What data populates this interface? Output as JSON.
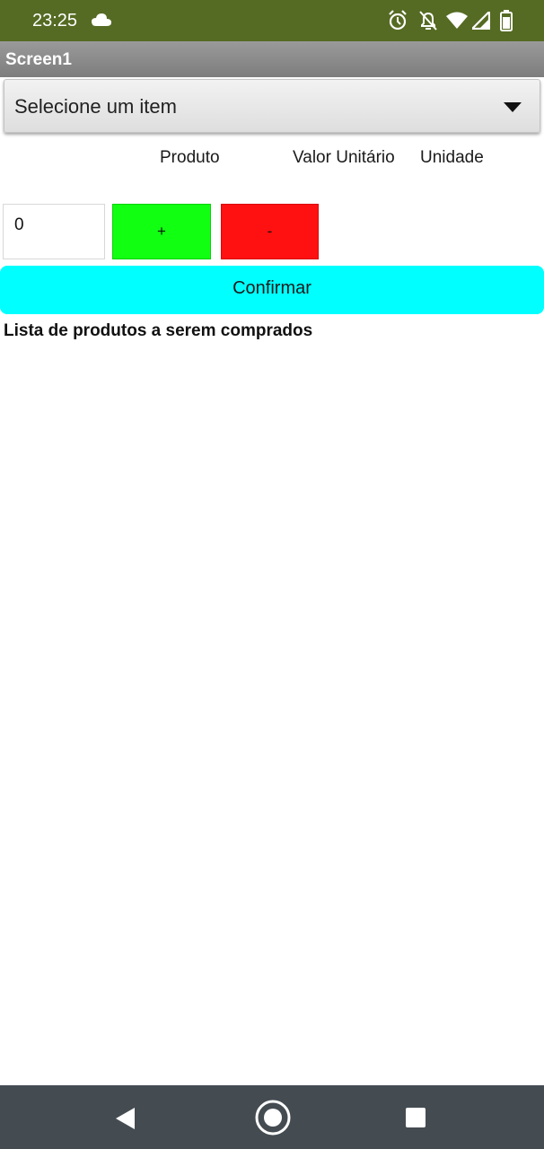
{
  "status_bar": {
    "time": "23:25",
    "icons": [
      "cloud-icon",
      "alarm-icon",
      "notifications-off-icon",
      "wifi-icon",
      "cell-signal-icon",
      "battery-icon"
    ]
  },
  "app": {
    "title": "Screen1"
  },
  "spinner": {
    "selected": "Selecione um item"
  },
  "headers": {
    "produto": "Produto",
    "valor_unitario": "Valor Unitário",
    "unidade": "Unidade"
  },
  "quantity": {
    "value": "0"
  },
  "buttons": {
    "plus": "+",
    "minus": "-",
    "confirm": "Confirmar"
  },
  "list": {
    "label": "Lista de produtos a serem comprados"
  },
  "nav": {
    "back": "back-icon",
    "home": "home-icon",
    "recents": "recents-icon"
  },
  "colors": {
    "status_bar": "#556b23",
    "plus_button": "#11ff11",
    "minus_button": "#ff1111",
    "confirm_button": "#00ffff",
    "nav_bar": "#444c52"
  }
}
